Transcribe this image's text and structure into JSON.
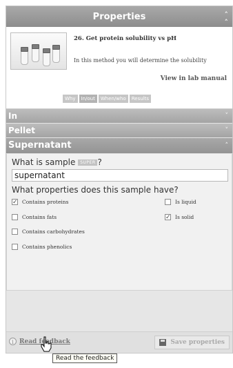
{
  "panel": {
    "title": "Properties",
    "collapse_icon": "double-chevron-up-icon"
  },
  "method": {
    "title": "26. Get protein solubility vs pH",
    "description": "In this method you will determine the solubility",
    "manual_link": "View in lab manual",
    "thumbnail": "lab-tubes-image",
    "tabs": [
      "Why",
      "In/out",
      "When/who",
      "Results"
    ],
    "active_tab": "In/out"
  },
  "sections": [
    {
      "label": "In",
      "state": "collapsed",
      "icon": "double-chevron-down-icon"
    },
    {
      "label": "Pellet",
      "state": "collapsed",
      "icon": "double-chevron-down-icon"
    },
    {
      "label": "Supernatant",
      "state": "expanded",
      "icon": "double-chevron-up-icon"
    }
  ],
  "supernatant": {
    "sample_question": "What is sample",
    "sample_badge": "SUPER",
    "sample_question_suffix": "?",
    "sample_value": "supernatant",
    "properties_question": "What properties does this sample have?",
    "options_left": [
      {
        "label": "Contains proteins",
        "checked": true
      },
      {
        "label": "Contains fats",
        "checked": false
      },
      {
        "label": "Contains carbohydrates",
        "checked": false
      },
      {
        "label": "Contains phenolics",
        "checked": false
      }
    ],
    "options_right": [
      {
        "label": "Is liquid",
        "checked": false
      },
      {
        "label": "Is solid",
        "checked": true
      }
    ]
  },
  "footer": {
    "feedback_label": "Read feedback",
    "feedback_icon": "info-icon",
    "save_label": "Save properties",
    "save_icon": "disk-icon",
    "save_enabled": false
  },
  "tooltip": "Read the feedback",
  "cursor": "hand-pointer-icon"
}
